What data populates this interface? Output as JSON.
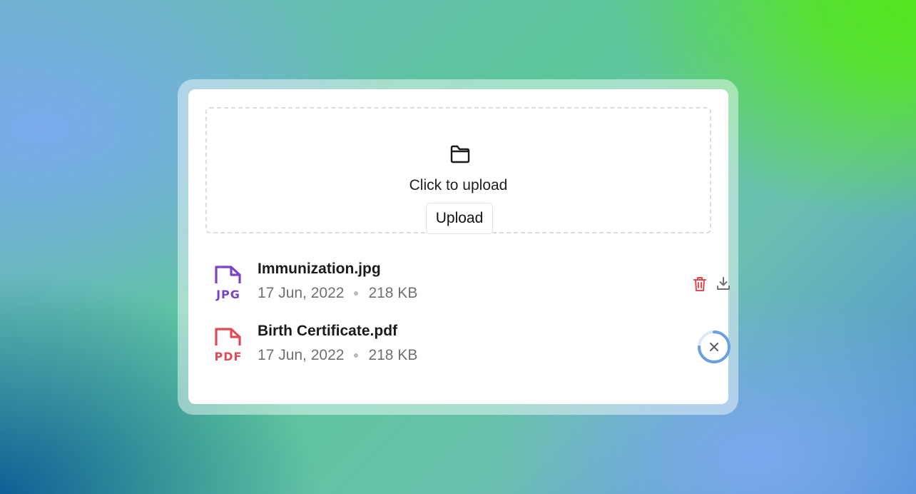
{
  "dropzone": {
    "icon": "folder-icon",
    "text": "Click to upload",
    "button_label": "Upload"
  },
  "files": [
    {
      "name": "Immunization.jpg",
      "type_label": "JPG",
      "type_icon": "jpg-file-icon",
      "color": "#7b43c8",
      "date": "17 Jun, 2022",
      "size": "218 KB",
      "status": "complete",
      "actions": [
        "trash-icon",
        "download-icon"
      ],
      "action_color_delete": "#e5484d"
    },
    {
      "name": "Birth Certificate.pdf",
      "type_label": "PDF",
      "type_icon": "pdf-file-icon",
      "color": "#e04a54",
      "date": "17 Jun, 2022",
      "size": "218 KB",
      "status": "uploading",
      "progress": 0.75,
      "actions": [
        "cancel-icon"
      ]
    }
  ],
  "colors": {
    "progress_ring": "#6aa0de",
    "progress_track": "#dfe7f2"
  }
}
